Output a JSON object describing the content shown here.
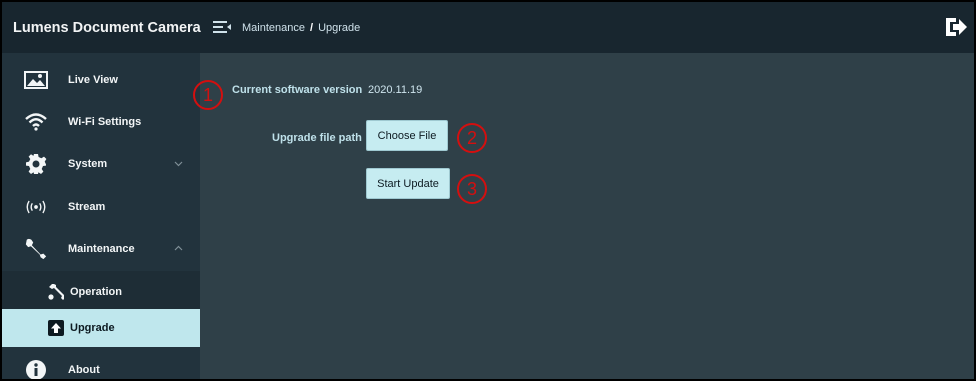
{
  "app": {
    "title": "Lumens Document Camera"
  },
  "breadcrumb": {
    "section": "Maintenance",
    "separator": "/",
    "page": "Upgrade"
  },
  "sidebar": {
    "items": [
      {
        "label": "Live View",
        "icon": "image-icon"
      },
      {
        "label": "Wi-Fi Settings",
        "icon": "wifi-icon"
      },
      {
        "label": "System",
        "icon": "gear-icon"
      },
      {
        "label": "Stream",
        "icon": "broadcast-icon"
      },
      {
        "label": "Maintenance",
        "icon": "wrench-icon"
      },
      {
        "label": "Operation",
        "icon": "wrench-icon"
      },
      {
        "label": "Upgrade",
        "icon": "upload-icon",
        "active": true
      },
      {
        "label": "About",
        "icon": "info-icon"
      }
    ]
  },
  "main": {
    "version_label": "Current software version",
    "version_value": "2020.11.19",
    "file_path_label": "Upgrade file path",
    "choose_file_label": "Choose File",
    "start_update_label": "Start Update"
  },
  "annotations": {
    "one": "1",
    "two": "2",
    "three": "3"
  },
  "colors": {
    "topbar": "#18262f",
    "sidebar": "#22333d",
    "content": "#2f4048",
    "active": "#bfe7ed",
    "button": "#c6ecf1",
    "callout": "#d40f0f"
  }
}
